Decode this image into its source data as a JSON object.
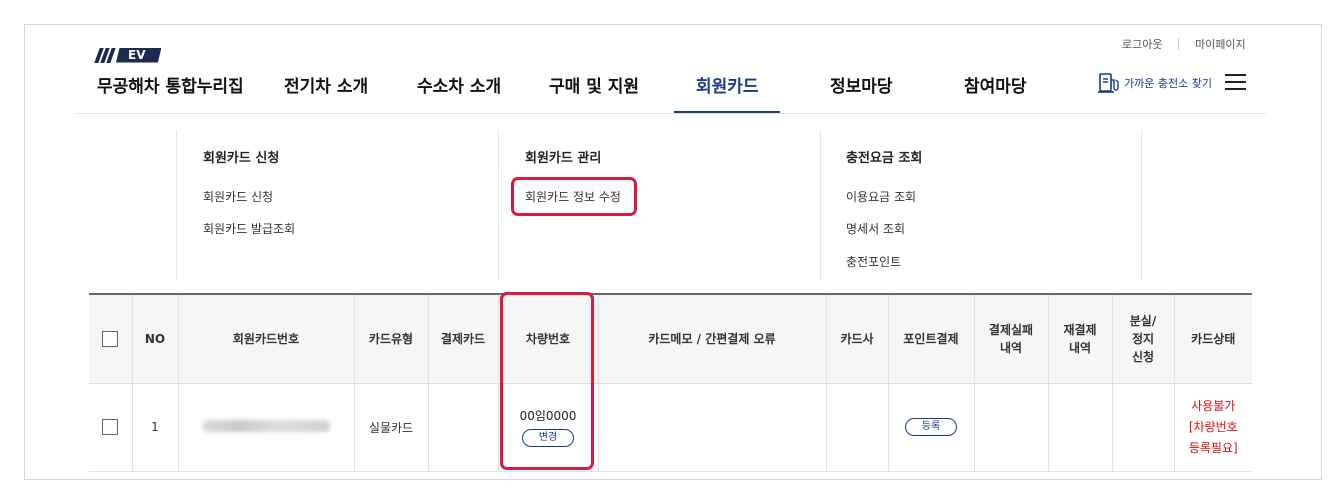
{
  "header": {
    "logo_text": "EV",
    "site_title": "무공해차 통합누리집",
    "util_links": {
      "logout": "로그아웃",
      "mypage": "마이페이지"
    },
    "nav": [
      {
        "label": "전기차 소개"
      },
      {
        "label": "수소차 소개"
      },
      {
        "label": "구매 및 지원"
      },
      {
        "label": "회원카드",
        "active": true
      },
      {
        "label": "정보마당"
      },
      {
        "label": "참여마당"
      }
    ],
    "charger_link": "가까운 충전소 찾기"
  },
  "submenu": [
    {
      "heading": "회원카드 신청",
      "links": [
        "회원카드 신청",
        "회원카드 발급조회"
      ]
    },
    {
      "heading": "회원카드 관리",
      "links": [
        "회원카드 정보 수정"
      ]
    },
    {
      "heading": "충전요금 조회",
      "links": [
        "이용요금 조회",
        "명세서 조회",
        "충전포인트"
      ]
    }
  ],
  "table": {
    "headers": {
      "no": "NO",
      "card_number": "회원카드번호",
      "card_type": "카드유형",
      "payment_card": "결제카드",
      "vehicle_number": "차량번호",
      "memo": "카드메모 / 간편결제 오류",
      "issuer": "카드사",
      "point_payment": "포인트결제",
      "payment_fail": "결제실패\n내역",
      "repayment": "재결제\n내역",
      "lost_stop": "분실/\n정지\n신청",
      "card_status": "카드상태"
    },
    "row": {
      "no": "1",
      "card_type": "실물카드",
      "payment_card": "",
      "vehicle_number": "00임0000",
      "change_button": "변경",
      "memo": "",
      "issuer": "",
      "register_button": "등록",
      "payment_fail": "",
      "repayment": "",
      "lost_stop": "",
      "card_status": "사용불가\n[차량번호\n등록필요]"
    }
  },
  "colors": {
    "accent_navy": "#1a3a8f",
    "highlight_red": "#d81b3c",
    "status_red": "#e01010"
  }
}
